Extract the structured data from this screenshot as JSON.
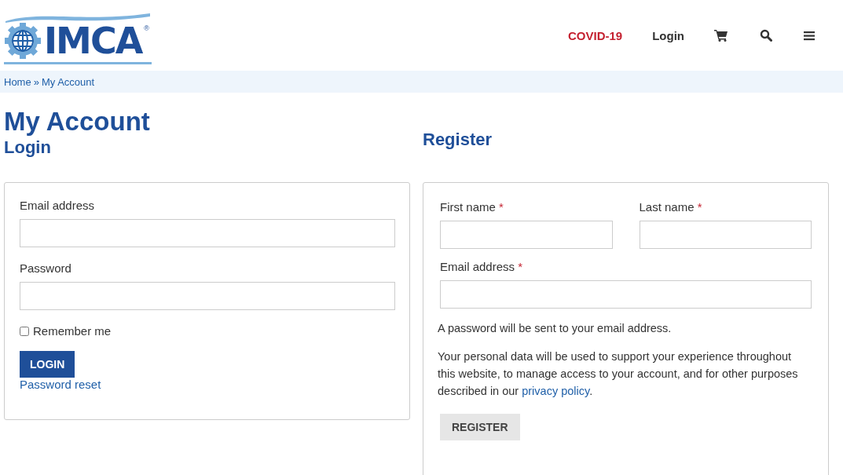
{
  "logo": {
    "text": "IMCA",
    "mark": "®"
  },
  "nav": [
    {
      "kind": "alert",
      "label": "COVID-19"
    },
    {
      "kind": "link",
      "label": "Login"
    },
    {
      "kind": "cart"
    },
    {
      "kind": "search"
    },
    {
      "kind": "menu"
    }
  ],
  "breadcrumb": {
    "items": [
      "Home",
      "My Account"
    ],
    "separator": "»"
  },
  "title": "My Account",
  "login": {
    "heading": "Login",
    "fields": [
      {
        "label": "Email address"
      },
      {
        "label": "Password"
      }
    ],
    "remember": {
      "label": "Remember me",
      "checked": false
    },
    "button": "LOGIN",
    "link": "Password reset"
  },
  "register": {
    "heading": "Register",
    "required_mark": "*",
    "fields": [
      {
        "label": "First name",
        "required": true,
        "kind": "half"
      },
      {
        "label": "Last name",
        "required": true,
        "kind": "half"
      },
      {
        "label": "Email address",
        "required": true,
        "kind": "full"
      }
    ],
    "note": "A password will be sent to your email address.",
    "privacy": {
      "text": "Your personal data will be used to support your experience throughout this website, to manage access to your account, and for other purposes described in our ",
      "link": "privacy policy",
      "end": "."
    },
    "button": "REGISTER"
  }
}
